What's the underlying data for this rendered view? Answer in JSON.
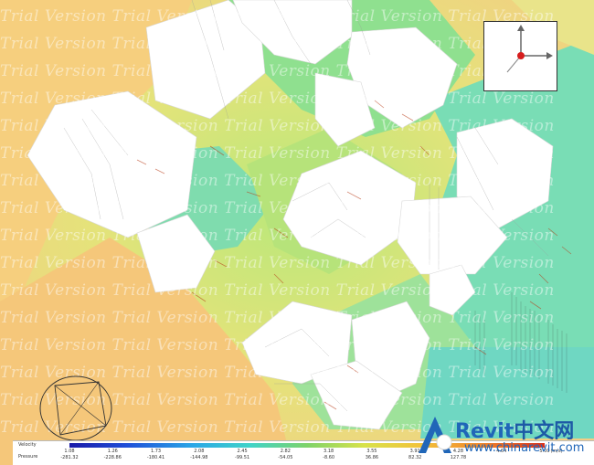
{
  "watermark": {
    "text": "Trial Version"
  },
  "legend": {
    "velocity_label": "Velocity",
    "pressure_label": "Pressure",
    "unit": "(m/s)",
    "velocity_ticks": [
      "1.08",
      "1.26",
      "1.73",
      "2.08",
      "2.45",
      "2.82",
      "3.18",
      "3.55",
      "3.91",
      "4.28",
      "4.64",
      "5.00"
    ],
    "pressure_ticks": [
      "-281.32",
      "-228.86",
      "-180.41",
      "-144.98",
      "-99.51",
      "-54.05",
      "-8.60",
      "36.86",
      "82.32",
      "127.78",
      "",
      ""
    ]
  },
  "logo": {
    "brand_latin": "Revit",
    "brand_cn": "中文网",
    "site": "www.chinarevit.com"
  },
  "colors": {
    "accent": "#2066b8",
    "field_orange": "#f6c77a",
    "field_green": "#8edb8c",
    "field_cyan": "#5fd9c8"
  }
}
